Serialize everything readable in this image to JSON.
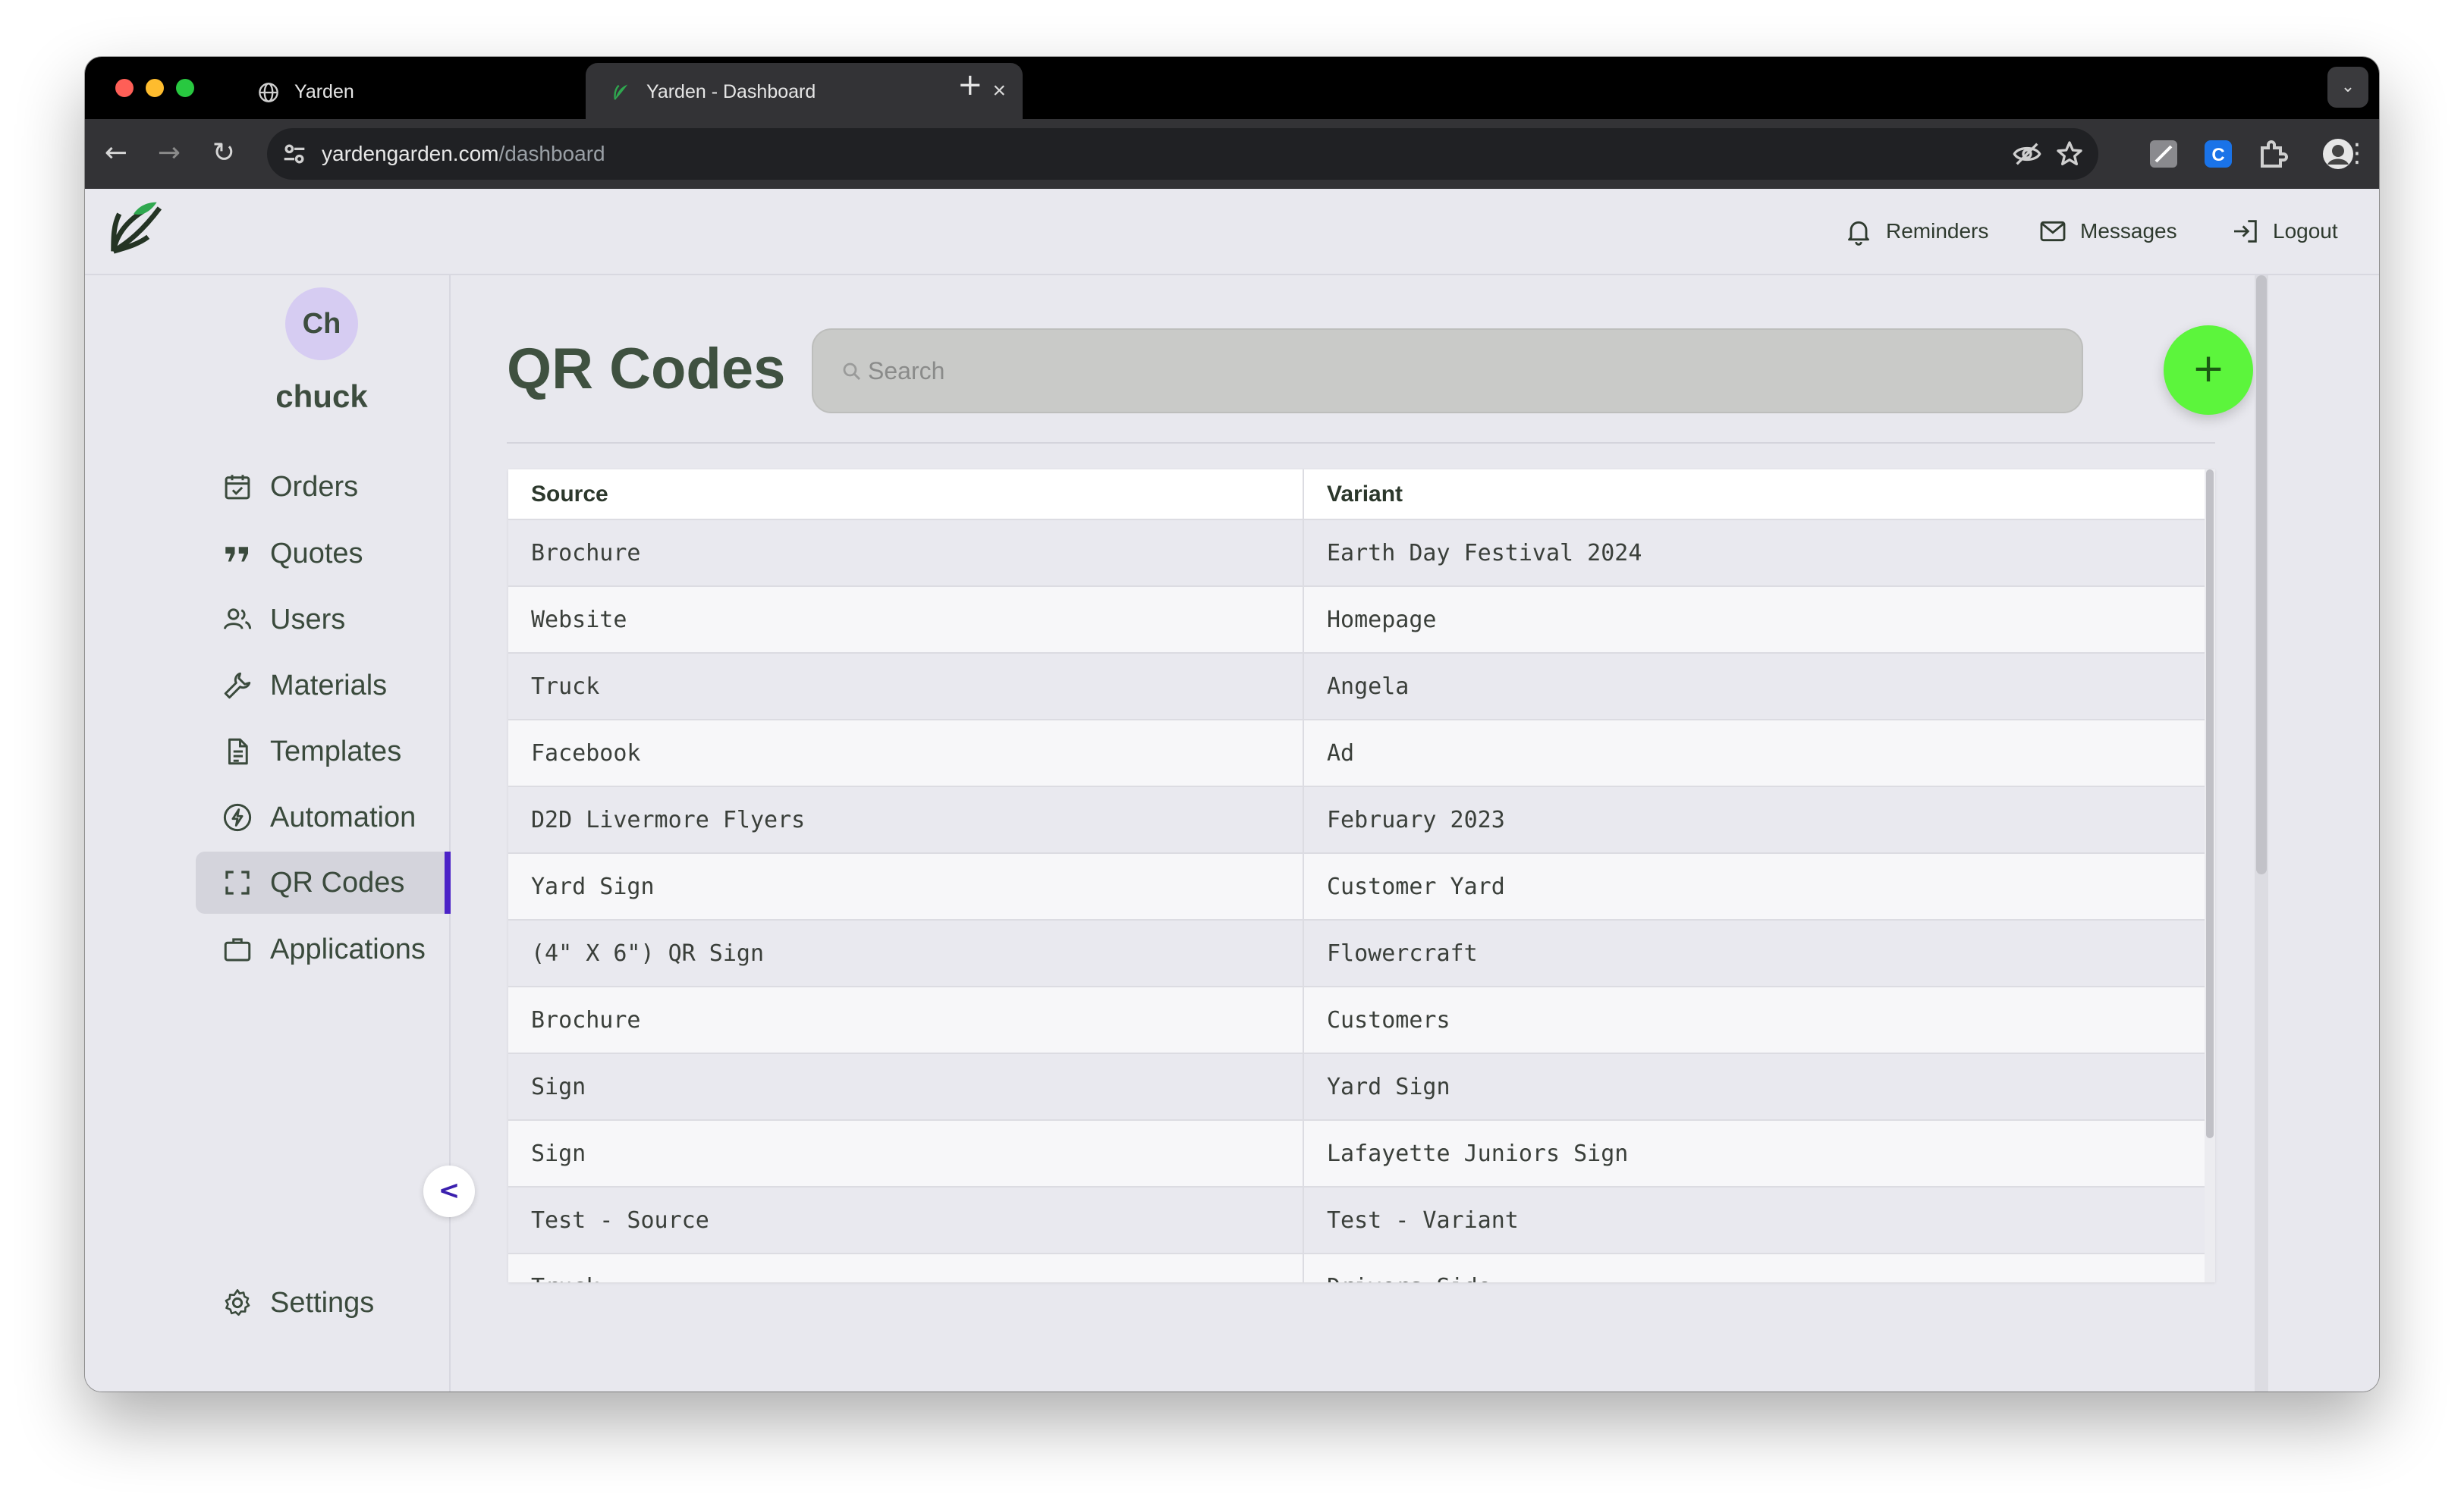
{
  "browser": {
    "tabs": [
      {
        "title": "Yarden"
      },
      {
        "title": "Yarden - Dashboard"
      }
    ],
    "new_tab_label": "+",
    "url_host": "yardengarden.com",
    "url_path": "/dashboard"
  },
  "header": {
    "reminders_label": "Reminders",
    "messages_label": "Messages",
    "logout_label": "Logout"
  },
  "user": {
    "initials": "Ch",
    "name": "chuck"
  },
  "sidebar": {
    "items": [
      {
        "label": "Orders",
        "icon": "calendar-check-icon"
      },
      {
        "label": "Quotes",
        "icon": "quote-icon"
      },
      {
        "label": "Users",
        "icon": "users-icon"
      },
      {
        "label": "Materials",
        "icon": "wrench-icon"
      },
      {
        "label": "Templates",
        "icon": "document-icon"
      },
      {
        "label": "Automation",
        "icon": "bolt-icon"
      },
      {
        "label": "QR Codes",
        "icon": "qr-frame-icon",
        "active": true
      },
      {
        "label": "Applications",
        "icon": "briefcase-icon"
      }
    ],
    "settings_label": "Settings",
    "collapse_label": "<"
  },
  "main": {
    "title": "QR Codes",
    "search_placeholder": "Search",
    "add_label": "+",
    "columns": [
      "Source",
      "Variant"
    ],
    "rows": [
      [
        "Brochure",
        "Earth Day Festival 2024"
      ],
      [
        "Website",
        "Homepage"
      ],
      [
        "Truck",
        "Angela"
      ],
      [
        "Facebook",
        "Ad"
      ],
      [
        "D2D Livermore Flyers",
        "February 2023"
      ],
      [
        "Yard Sign",
        "Customer Yard"
      ],
      [
        "(4\" X 6\") QR Sign",
        "Flowercraft"
      ],
      [
        "Brochure",
        "Customers"
      ],
      [
        "Sign",
        "Yard Sign"
      ],
      [
        "Sign",
        "Lafayette Juniors Sign"
      ],
      [
        "Test - Source",
        "Test - Variant"
      ],
      [
        "Truck",
        "Drivers Side"
      ]
    ]
  },
  "colors": {
    "accent": "#4b22c7",
    "add_button": "#5cf53c",
    "heading": "#3f5140"
  }
}
